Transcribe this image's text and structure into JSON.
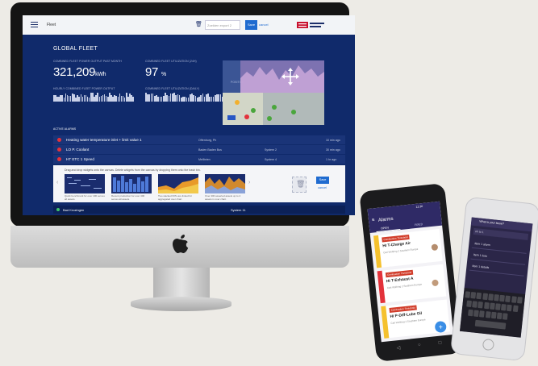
{
  "desktop": {
    "app_title": "Fleet",
    "search_placeholder": "Zoekten export 2",
    "save_label": "Save",
    "cancel_label": "cancel",
    "section_title": "GLOBAL FLEET",
    "metric1_label": "COMBINED FLEET POWER OUTPUT PAST MONTH",
    "metric1_value": "321,209",
    "metric1_unit": "kWh",
    "metric2_label": "COMBINED FLEET UTILIZATION (24H)",
    "metric2_value": "97",
    "metric2_unit": "%",
    "sub1_label": "HOURLY COMBINED FLEET POWER OUTPUT",
    "sub2_label": "COMBINED FLEET UTILIZATION (DAILY)",
    "position_label": "POSITION",
    "active_alarms_label": "ACTIVE ALARMS",
    "alarms": [
      {
        "text": "Heating water temperature inlet + limit value 1",
        "site": "Offenburg, Ph",
        "system": "",
        "time": "10 min ago"
      },
      {
        "text": "LO P. Coolant",
        "site": "Baden Baden Bus",
        "system": "System 2",
        "time": "30 min ago"
      },
      {
        "text": "HT ETC 1 Speed",
        "site": "Mellbrien",
        "system": "System 4",
        "time": "1 hr ago"
      }
    ],
    "panel_hint": "Drag and drop widgets onto the canvas. Delete widgets from the canvas by dropping them onto the trash bin.",
    "widget_captions": [
      "Quick benchmark for over 400 serves all assets.",
      "Recent production for over 400 serves all assets.",
      "Two stacked KPIs are linked for aggregated over chart.",
      "Over 400 asserted assets up to 4 assets in over chart."
    ],
    "widget_save": "Save",
    "widget_cancel": "cancel",
    "status_site": "Bad Krozingen",
    "status_system": "System 11"
  },
  "android": {
    "title": "Alarms",
    "tabs": [
      "OPEN",
      "FIXED"
    ],
    "cards": [
      {
        "badge": "Combustion Threshold",
        "title": "HI T-Charge Air",
        "sub": "Carl Wolfring 2\nSouthern Europe"
      },
      {
        "badge": "Combustion Threshold",
        "title": "HI T-Exhaust A",
        "sub": "Carl Wolfring 2\nSouthern Europe"
      },
      {
        "badge": "Combustion Threshold",
        "title": "Hi P-Diff-Lube Oil",
        "sub": "Carl Wolfring 2\nSouthern Europe"
      }
    ],
    "time": "12:30"
  },
  "iphone": {
    "question": "What is your issue?",
    "query": "oh to 1",
    "items": [
      "Item 1 alarm",
      "Item 1 loss",
      "Item 1 details"
    ]
  },
  "colors": {
    "screen_bg": "#102a6b",
    "alarm_red": "#e3323b",
    "accent_blue": "#1f6bd0",
    "card_yellow": "#f5c12e"
  }
}
